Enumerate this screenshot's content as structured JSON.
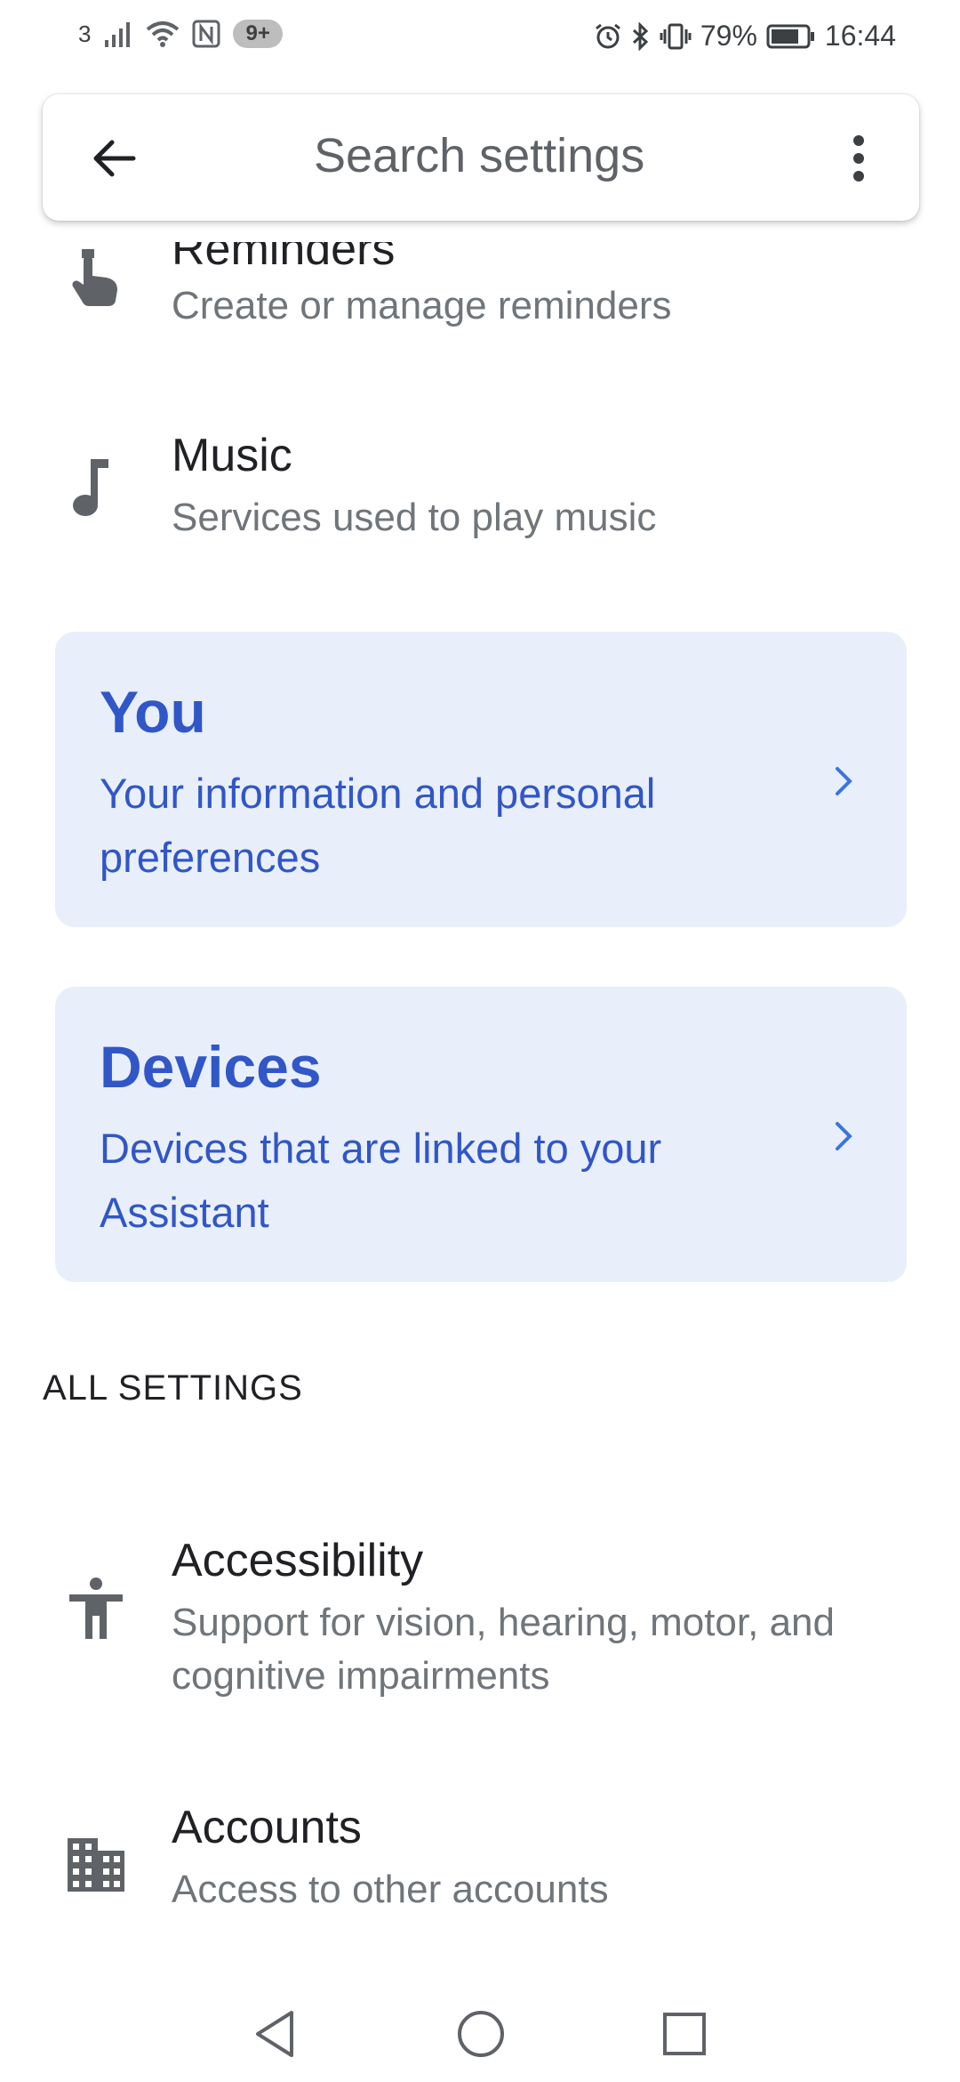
{
  "status_bar": {
    "carrier_badge": "3",
    "notification_badge": "9+",
    "battery_percent": "79%",
    "time": "16:44",
    "icons": [
      "signal-icon",
      "wifi-icon",
      "nfc-icon",
      "alarm-icon",
      "bluetooth-icon",
      "vibrate-icon",
      "battery-icon"
    ]
  },
  "search": {
    "placeholder": "Search settings"
  },
  "items_top": [
    {
      "title": "Reminders",
      "subtitle": "Create or manage reminders",
      "icon": "touch-hand-icon"
    },
    {
      "title": "Music",
      "subtitle": "Services used to play music",
      "icon": "music-note-icon"
    }
  ],
  "cards": [
    {
      "title": "You",
      "description": "Your information and personal preferences"
    },
    {
      "title": "Devices",
      "description": "Devices that are linked to your Assistant"
    }
  ],
  "section": {
    "all_settings": "ALL SETTINGS"
  },
  "items_bottom": [
    {
      "title": "Accessibility",
      "subtitle": "Support for vision, hearing, motor, and cognitive impairments",
      "icon": "accessibility-icon"
    },
    {
      "title": "Accounts",
      "subtitle": "Access to other accounts",
      "icon": "building-icon"
    }
  ],
  "colors": {
    "card_bg": "#e8effb",
    "card_text": "#3156c7",
    "icon_gray": "#5f6368"
  }
}
